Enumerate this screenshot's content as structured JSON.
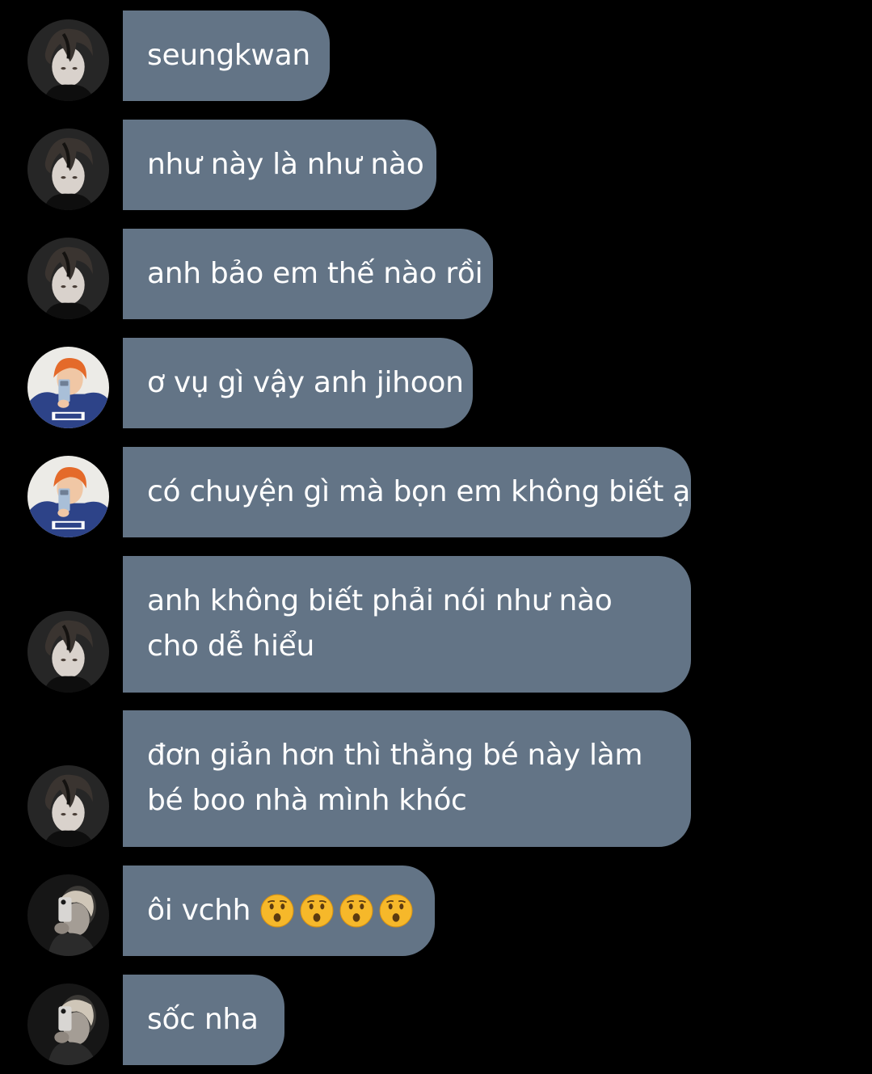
{
  "colors": {
    "background": "#000000",
    "bubble": "#637486",
    "text": "#ffffff",
    "emoji_face": "#f6b82a"
  },
  "messages": [
    {
      "sender_avatar": "dark-hair-avatar",
      "text": "seungkwan"
    },
    {
      "sender_avatar": "dark-hair-avatar",
      "text": "như này là như nào"
    },
    {
      "sender_avatar": "dark-hair-avatar",
      "text": "anh bảo em thế nào rồi"
    },
    {
      "sender_avatar": "orange-hair-avatar",
      "text": "ơ vụ gì vậy anh jihoon"
    },
    {
      "sender_avatar": "orange-hair-avatar",
      "text": "có chuyện gì mà bọn em không biết ạ"
    },
    {
      "sender_avatar": "dark-hair-avatar",
      "text": "anh không biết phải nói như nào cho dễ hiểu"
    },
    {
      "sender_avatar": "dark-hair-avatar",
      "text": "đơn giản hơn thì thằng bé này làm bé boo nhà mình khóc"
    },
    {
      "sender_avatar": "blonde-phone-avatar",
      "text": "ôi vchh",
      "emojis": [
        "hushed-face-emoji",
        "hushed-face-emoji",
        "hushed-face-emoji",
        "hushed-face-emoji"
      ]
    },
    {
      "sender_avatar": "blonde-phone-avatar",
      "text": "sốc nha"
    }
  ]
}
